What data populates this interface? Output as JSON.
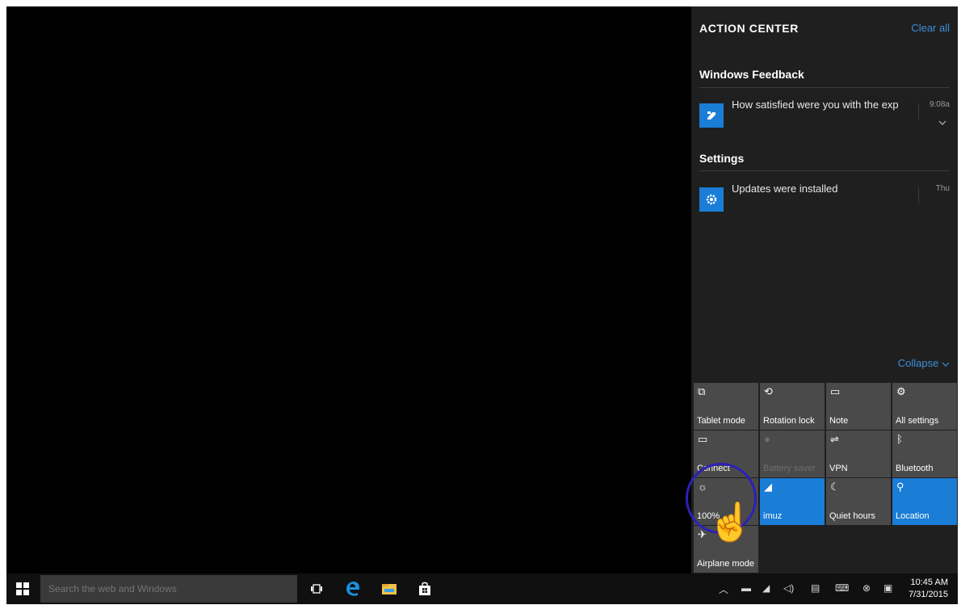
{
  "action_center": {
    "title": "ACTION CENTER",
    "clear_all": "Clear all",
    "groups": [
      {
        "name": "Windows Feedback",
        "notifications": [
          {
            "text": "How satisfied were you with the exp",
            "time": "9:08a",
            "icon": "feedback-icon"
          }
        ]
      },
      {
        "name": "Settings",
        "notifications": [
          {
            "text": "Updates were installed",
            "time": "Thu",
            "icon": "gear-icon"
          }
        ]
      }
    ],
    "collapse": "Collapse",
    "quick_actions": [
      {
        "label": "Tablet mode",
        "icon": "tablet-mode-icon",
        "state": "off"
      },
      {
        "label": "Rotation lock",
        "icon": "rotation-lock-icon",
        "state": "off"
      },
      {
        "label": "Note",
        "icon": "note-icon",
        "state": "off"
      },
      {
        "label": "All settings",
        "icon": "gear-icon",
        "state": "off"
      },
      {
        "label": "Connect",
        "icon": "connect-icon",
        "state": "off"
      },
      {
        "label": "Battery saver",
        "icon": "battery-saver-icon",
        "state": "disabled"
      },
      {
        "label": "VPN",
        "icon": "vpn-icon",
        "state": "off"
      },
      {
        "label": "Bluetooth",
        "icon": "bluetooth-icon",
        "state": "off"
      },
      {
        "label": "100%",
        "icon": "brightness-icon",
        "state": "off"
      },
      {
        "label": "imuz",
        "icon": "wifi-icon",
        "state": "on"
      },
      {
        "label": "Quiet hours",
        "icon": "moon-icon",
        "state": "off"
      },
      {
        "label": "Location",
        "icon": "location-icon",
        "state": "on"
      },
      {
        "label": "Airplane mode",
        "icon": "airplane-icon",
        "state": "off"
      }
    ]
  },
  "taskbar": {
    "search_placeholder": "Search the web and Windows",
    "clock_time": "10:45 AM",
    "clock_date": "7/31/2015"
  },
  "colors": {
    "accent": "#1a7dd6",
    "link": "#3b8fd9",
    "highlight_circle": "#2b21b8"
  }
}
